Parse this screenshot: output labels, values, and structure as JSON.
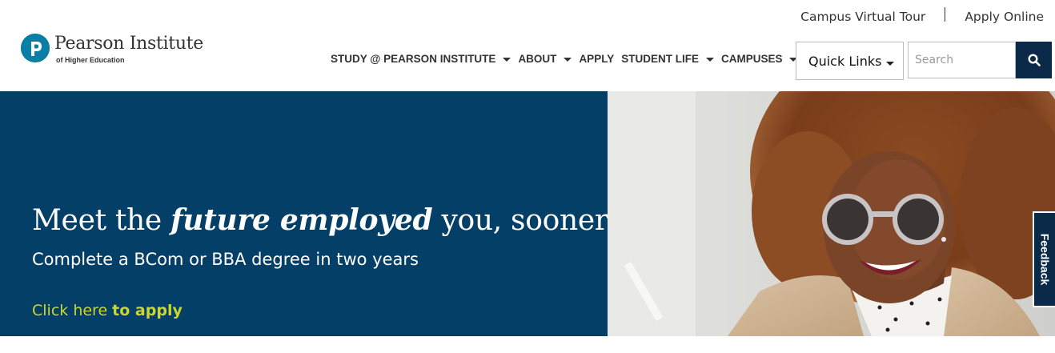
{
  "brand": {
    "name": "Pearson Institute",
    "subtitle": "of Higher Education",
    "logo_color": "#0a7ea4"
  },
  "top_links": [
    {
      "label": "Campus Virtual Tour"
    },
    {
      "label": "Apply Online"
    }
  ],
  "nav": {
    "items": [
      {
        "label": "STUDY @ PEARSON INSTITUTE",
        "has_dropdown": true
      },
      {
        "label": "ABOUT",
        "has_dropdown": true
      },
      {
        "label": "APPLY",
        "has_dropdown": false
      },
      {
        "label": "STUDENT LIFE",
        "has_dropdown": true
      },
      {
        "label": "CAMPUSES",
        "has_dropdown": true
      }
    ]
  },
  "quick_links": {
    "label": "Quick Links"
  },
  "search": {
    "placeholder": "Search",
    "icon": "search-icon",
    "button_color": "#0b2a4a"
  },
  "banner": {
    "headline_pre": "Meet the ",
    "headline_em": "future employed",
    "headline_post": " you, sooner!",
    "subheadline": "Complete a BCom or BBA degree in two years",
    "cta_pre": "Click here ",
    "cta_bold": "to apply",
    "background_color": "#043f67",
    "cta_color": "#c8d830"
  },
  "feedback": {
    "label": "Feedback"
  }
}
